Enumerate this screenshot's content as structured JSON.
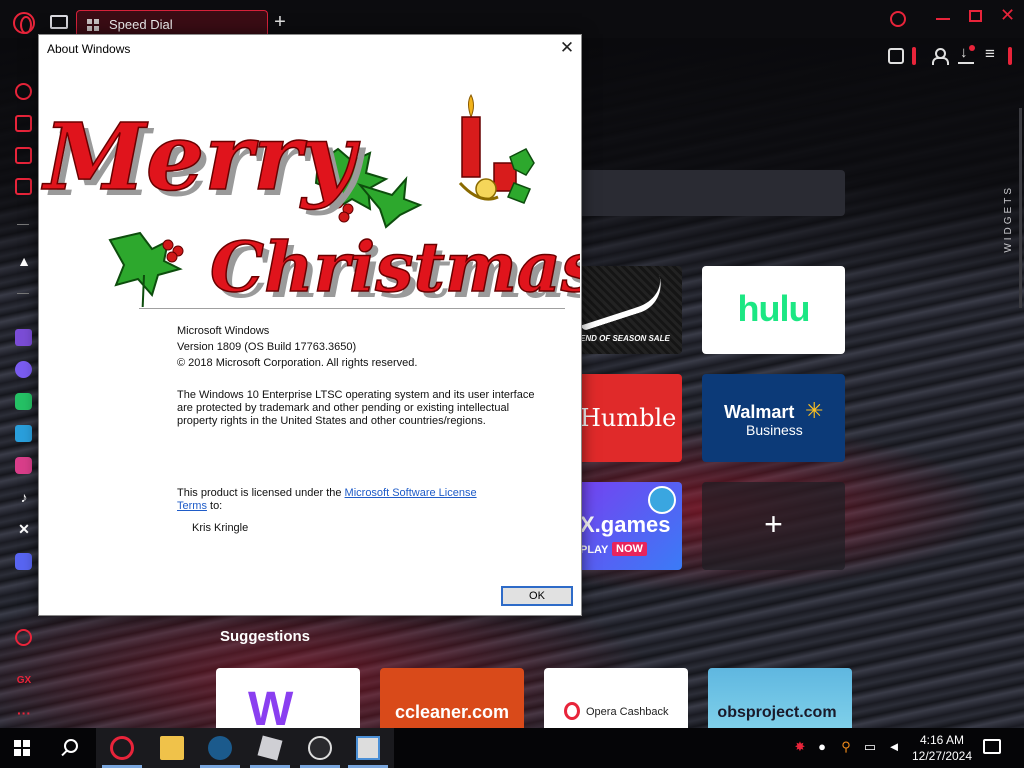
{
  "browser": {
    "tab_title": "Speed Dial",
    "widgets_label": "WIDGETS",
    "accent": "#e8243a",
    "icons": [
      "opera-logo-icon",
      "tab-switcher-icon",
      "grid-icon",
      "plus-icon",
      "search-icon",
      "minimize-icon",
      "maximize-icon",
      "close-icon",
      "camera-icon",
      "user-icon",
      "download-icon",
      "easy-setup-icon"
    ]
  },
  "sidebar": {
    "items": [
      "speed-icon",
      "gx-control-icon",
      "twitch-tv-icon",
      "gx-corner-icon",
      "aria-icon",
      "twitch-icon",
      "messenger-icon",
      "whatsapp-icon",
      "telegram-icon",
      "instagram-icon",
      "tiktok-icon",
      "x-icon",
      "discord-icon",
      "player-icon",
      "gx-logo-icon",
      "more-icon"
    ],
    "gx_label": "GX",
    "more_label": "···"
  },
  "speed_dial": {
    "nike_caption": "END OF SEASON SALE",
    "hulu": "hulu",
    "humble": "Humble",
    "walmart": "Walmart",
    "walmart_sub": "Business",
    "xgames": "X.games",
    "xgames_play": "PLAY",
    "xgames_now": "NOW",
    "add_label": "+"
  },
  "suggestions": {
    "title": "Suggestions",
    "items": [
      "W",
      "ccleaner.com",
      "Opera Cashback",
      "obsproject.com"
    ]
  },
  "dialog": {
    "title": "About Windows",
    "close_label": "✕",
    "banner_line1": "Merry",
    "banner_line2": "Christmas",
    "product": "Microsoft Windows",
    "version": "Version 1809 (OS Build 17763.3650)",
    "copyright": "© 2018 Microsoft Corporation. All rights reserved.",
    "legal": "The Windows 10 Enterprise LTSC operating system and its user interface are protected by trademark and other pending or existing intellectual property rights in the United States and other countries/regions.",
    "license_prefix": "This product is licensed under the ",
    "license_link": "Microsoft Software License Terms",
    "license_suffix": " to:",
    "licensed_user": "Kris Kringle",
    "ok_label": "OK"
  },
  "taskbar": {
    "apps": [
      "start-icon",
      "search-icon",
      "opera-gx-icon",
      "file-explorer-icon",
      "steam-icon",
      "roblox-icon",
      "obs-icon",
      "winver-icon"
    ],
    "tray": [
      "tray-app-icon",
      "water-drop-icon",
      "key-icon",
      "network-icon",
      "volume-muted-icon"
    ],
    "time": "4:16 AM",
    "date": "12/27/2024"
  }
}
